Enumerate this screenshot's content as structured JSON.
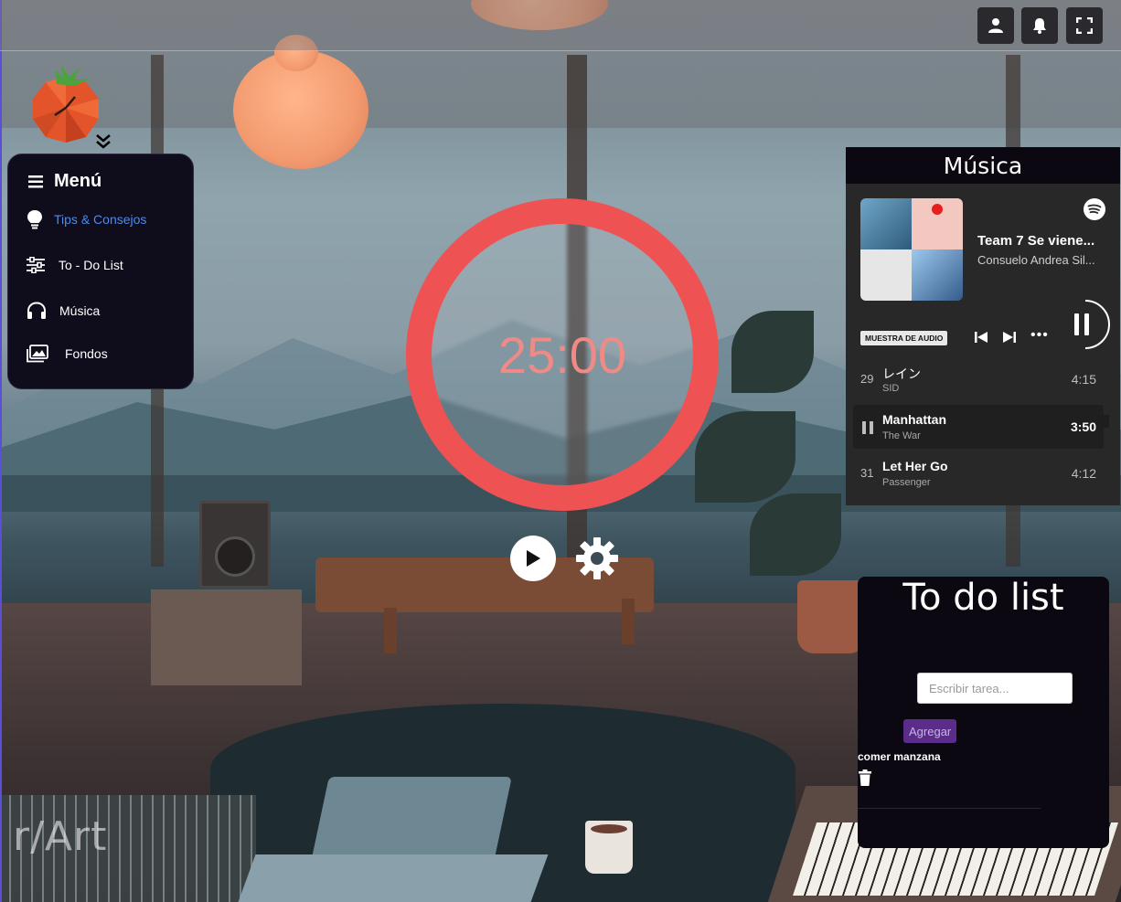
{
  "topbar": {
    "buttons": [
      {
        "icon": "user-icon"
      },
      {
        "icon": "bell-icon"
      },
      {
        "icon": "fullscreen-icon"
      }
    ]
  },
  "menu": {
    "title": "Menú",
    "items": [
      {
        "label": "Tips & Consejos",
        "icon": "lightbulb-icon",
        "color": "#4b8cf0"
      },
      {
        "label": "To - Do List",
        "icon": "sliders-icon",
        "color": "#ffffff"
      },
      {
        "label": "Música",
        "icon": "headphones-icon",
        "color": "#ffffff"
      },
      {
        "label": "Fondos",
        "icon": "images-icon",
        "color": "#ffffff"
      }
    ]
  },
  "timer": {
    "time": "25:00",
    "ring_color": "#ef5253",
    "text_color": "#f08a86"
  },
  "music": {
    "title": "Música",
    "player": {
      "track_title": "Team 7 Se viene...",
      "track_artist": "Consuelo Andrea Sil...",
      "badge": "MUESTRA DE AUDIO",
      "more": "•••"
    },
    "tracks": [
      {
        "num": "29",
        "title": "レイン",
        "artist": "SID",
        "duration": "4:15",
        "active": false
      },
      {
        "num": "",
        "title": "Manhattan",
        "artist": "The War",
        "duration": "3:50",
        "active": true
      },
      {
        "num": "31",
        "title": "Let Her Go",
        "artist": "Passenger",
        "duration": "4:12",
        "active": false
      }
    ]
  },
  "todo": {
    "title": "To do list",
    "input_placeholder": "Escribir tarea...",
    "add_label": "Agregar",
    "items": [
      "comer manzana"
    ]
  },
  "background": {
    "watermark": "r/Art"
  }
}
